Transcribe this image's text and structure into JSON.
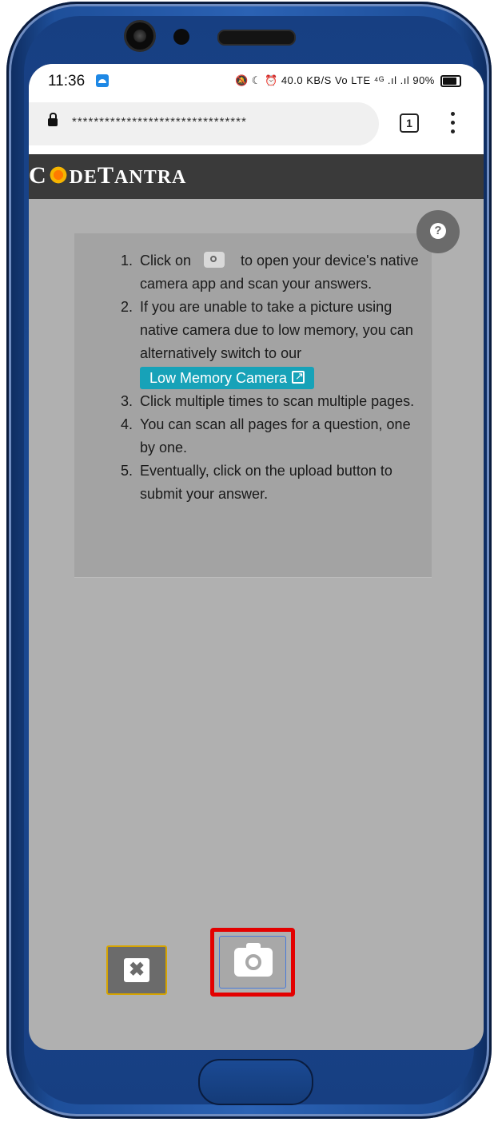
{
  "status_bar": {
    "time": "11:36",
    "right_icons": "🔕 ☾ ⏰ 40.0 KB/S Vo LTE ⁴ᴳ .ıl .ıl 90%"
  },
  "browser": {
    "url_masked": "********************************",
    "tab_count": "1"
  },
  "app": {
    "logo_c": "C",
    "logo_rest_1": "DE",
    "logo_t": "T",
    "logo_rest_2": "ANTRA"
  },
  "help": {
    "icon_text": "?"
  },
  "instructions": {
    "items": [
      {
        "num": "1.",
        "pre": "Click on",
        "post": "to open your device's native camera app and scan your answers."
      },
      {
        "num": "2.",
        "text": "If you are unable to take a picture using native camera due to low memory, you can alternatively switch to our",
        "button": "Low Memory Camera"
      },
      {
        "num": "3.",
        "text": "Click multiple times to scan multiple pages."
      },
      {
        "num": "4.",
        "text": "You can scan all pages for a question, one by one."
      },
      {
        "num": "5.",
        "text": "Eventually, click on the upload button to submit your answer."
      }
    ]
  },
  "controls": {
    "close_symbol": "✖"
  },
  "colors": {
    "accent_button": "#17a2b8",
    "highlight_border": "#e30000",
    "header_bg": "#3a3a3a",
    "screen_bg": "#b0b0b0"
  },
  "icons": [
    "lock-icon",
    "tabs-icon",
    "menu-icon",
    "help-icon",
    "camera-icon",
    "external-link-icon",
    "close-icon",
    "notification-icon",
    "battery-icon"
  ]
}
